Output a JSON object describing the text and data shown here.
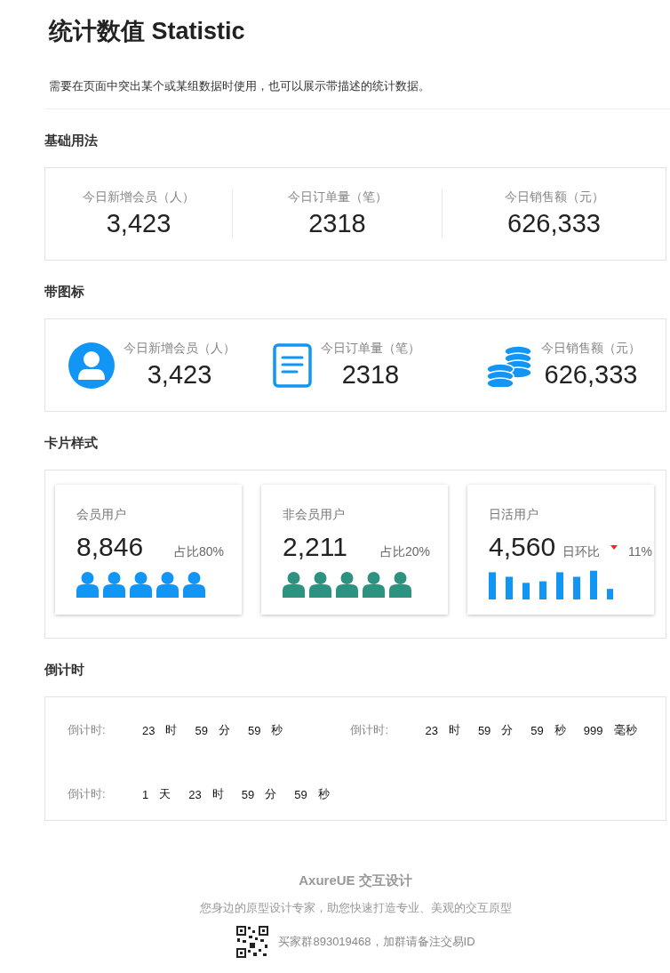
{
  "title": "统计数值 Statistic",
  "description": "需要在页面中突出某个或某组数据时使用，也可以展示带描述的统计数据。",
  "basic": {
    "heading": "基础用法",
    "stats": [
      {
        "label": "今日新增会员（人）",
        "value": "3,423"
      },
      {
        "label": "今日订单量（笔）",
        "value": "2318"
      },
      {
        "label": "今日销售额（元）",
        "value": "626,333"
      }
    ]
  },
  "with_icons": {
    "heading": "带图标",
    "stats": [
      {
        "kind": "user",
        "label": "今日新增会员（人）",
        "value": "3,423"
      },
      {
        "kind": "document",
        "label": "今日订单量（笔）",
        "value": "2318"
      },
      {
        "kind": "coins",
        "label": "今日销售额（元）",
        "value": "626,333"
      }
    ]
  },
  "cards": {
    "heading": "卡片样式",
    "items": [
      {
        "kind": "people",
        "label": "会员用户",
        "value": "8,846",
        "ratio": "占比80%",
        "color": "#1296f5"
      },
      {
        "kind": "people",
        "label": "非会员用户",
        "value": "2,211",
        "ratio": "占比20%",
        "color": "#2e9280"
      },
      {
        "kind": "bars",
        "label": "日活用户",
        "value": "4,560",
        "trend_label": "日环比",
        "trend_down": true,
        "trend": "11%",
        "color": "#1296f5"
      }
    ]
  },
  "countdown": {
    "heading": "倒计时",
    "rows": [
      {
        "timers": [
          {
            "label": "倒计时:",
            "parts": [
              {
                "value": "23",
                "unit": "时"
              },
              {
                "value": "59",
                "unit": "分"
              },
              {
                "value": "59",
                "unit": "秒"
              }
            ]
          },
          {
            "label": "倒计时:",
            "parts": [
              {
                "value": "23",
                "unit": "时"
              },
              {
                "value": "59",
                "unit": "分"
              },
              {
                "value": "59",
                "unit": "秒"
              },
              {
                "value": "999",
                "unit": "毫秒"
              }
            ]
          }
        ]
      },
      {
        "timers": [
          {
            "label": "倒计时:",
            "parts": [
              {
                "value": "1",
                "unit": "天"
              },
              {
                "value": "23",
                "unit": "时"
              },
              {
                "value": "59",
                "unit": "分"
              },
              {
                "value": "59",
                "unit": "秒"
              }
            ]
          }
        ]
      }
    ]
  },
  "footer": {
    "brand": "AxureUE 交互设计",
    "slogan": "您身边的原型设计专家，助您快速打造专业、美观的交互原型",
    "contact": "买家群893019468，加群请备注交易ID"
  }
}
